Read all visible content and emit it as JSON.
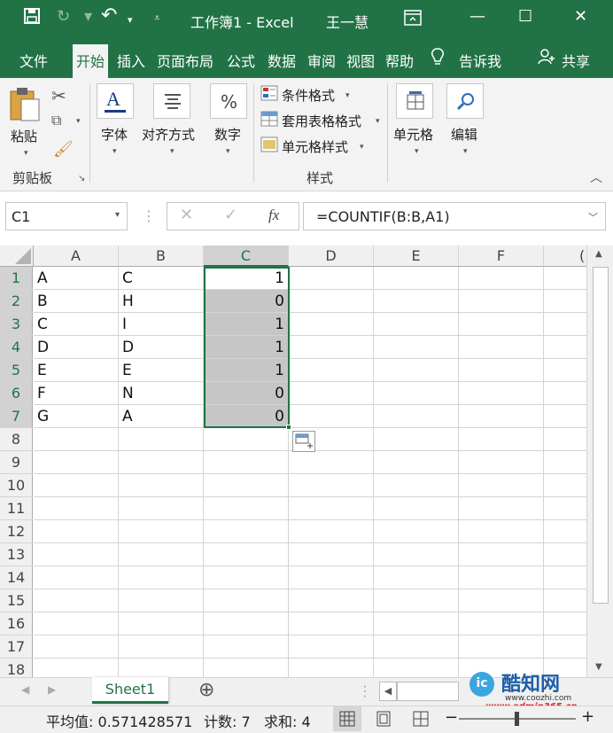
{
  "titlebar": {
    "save_icon": "save-icon",
    "undo_icon": "undo-icon",
    "redo_icon": "redo-icon",
    "customize_icon": "customize-qat-icon",
    "title": "工作簿1 -  Excel",
    "user": "王一慧",
    "ribbon_display_icon": "ribbon-display-options-icon",
    "minimize": "—",
    "maximize": "☐",
    "close": "✕"
  },
  "tabs": {
    "file": "文件",
    "home": "开始",
    "insert": "插入",
    "page_layout": "页面布局",
    "formulas": "公式",
    "data": "数据",
    "review": "审阅",
    "view": "视图",
    "help": "帮助",
    "tell_me": "告诉我",
    "share": "共享"
  },
  "ribbon": {
    "paste": "粘贴",
    "clipboard": "剪贴板",
    "font": "字体",
    "alignment": "对齐方式",
    "number": "数字",
    "conditional_formatting": "条件格式",
    "format_as_table": "套用表格格式",
    "cell_styles": "单元格样式",
    "styles": "样式",
    "cells": "单元格",
    "editing": "编辑"
  },
  "formula_bar": {
    "name_box": "C1",
    "cancel": "✕",
    "enter": "✓",
    "fx": "fx",
    "formula": "=COUNTIF(B:B,A1)"
  },
  "grid": {
    "columns": [
      "A",
      "B",
      "C",
      "D",
      "E",
      "F",
      "("
    ],
    "rows": [
      "1",
      "2",
      "3",
      "4",
      "5",
      "6",
      "7",
      "8",
      "9",
      "10",
      "11",
      "12",
      "13",
      "14",
      "15",
      "16",
      "17",
      "18"
    ],
    "data": [
      [
        "A",
        "C",
        "1"
      ],
      [
        "B",
        "H",
        "0"
      ],
      [
        "C",
        "I",
        "1"
      ],
      [
        "D",
        "D",
        "1"
      ],
      [
        "E",
        "E",
        "1"
      ],
      [
        "F",
        "N",
        "0"
      ],
      [
        "G",
        "A",
        "0"
      ]
    ]
  },
  "sheets": {
    "active": "Sheet1",
    "add": "⊕"
  },
  "status": {
    "average": "平均值: 0.571428571",
    "count": "计数: 7",
    "sum": "求和: 4",
    "zoom_minus": "−",
    "zoom_plus": "+"
  },
  "watermark": {
    "brand": "酷知网",
    "url": "www.coozhi.com",
    "url2": "www.admin365.cn"
  },
  "colors": {
    "accent": "#217346",
    "selection_fill": "#c6c6c6"
  }
}
